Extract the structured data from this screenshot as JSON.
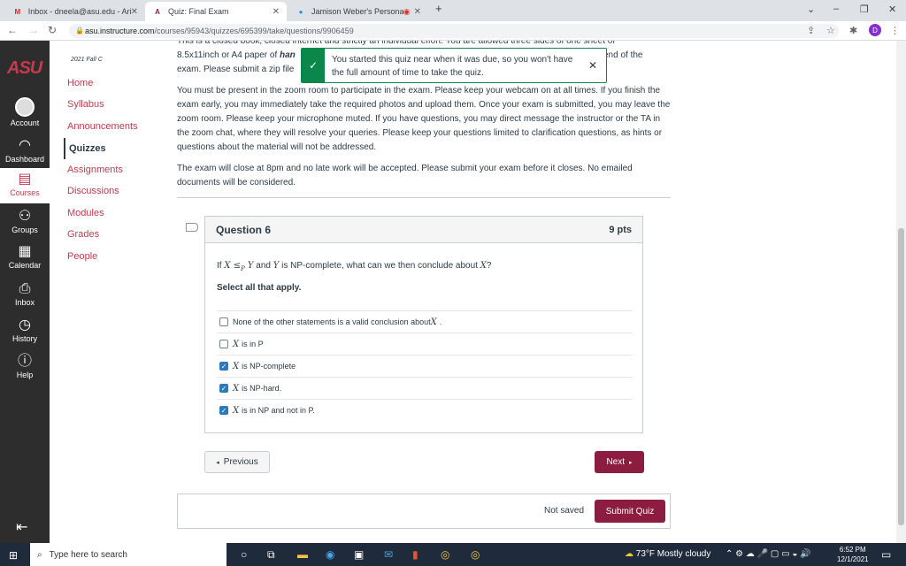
{
  "browser": {
    "tabs": [
      {
        "label": "Inbox - dneela@asu.edu - Arizona",
        "icon": "gmail-icon"
      },
      {
        "label": "Quiz: Final Exam",
        "icon": "asu-icon"
      },
      {
        "label": "Jamison Weber's Personal M",
        "icon": "zoom-icon"
      }
    ],
    "url_host": "asu.instructure.com",
    "url_path": "/courses/95943/quizzes/695399/take/questions/9906459",
    "profile_initial": "D"
  },
  "global_nav": {
    "logo": "ASU",
    "items": [
      {
        "label": "Account",
        "icon": "account-icon"
      },
      {
        "label": "Dashboard",
        "icon": "dashboard-icon"
      },
      {
        "label": "Courses",
        "icon": "courses-icon"
      },
      {
        "label": "Groups",
        "icon": "groups-icon"
      },
      {
        "label": "Calendar",
        "icon": "calendar-icon"
      },
      {
        "label": "Inbox",
        "icon": "inbox-icon"
      },
      {
        "label": "History",
        "icon": "history-icon"
      },
      {
        "label": "Help",
        "icon": "help-icon"
      }
    ]
  },
  "course_nav": {
    "term": "2021 Fall C",
    "items": [
      "Home",
      "Syllabus",
      "Announcements",
      "Quizzes",
      "Assignments",
      "Discussions",
      "Modules",
      "Grades",
      "People"
    ],
    "active": "Quizzes"
  },
  "instructions": {
    "p0": "This is a closed book, closed internet and strictly an individual effort. You are allowed three sides of one sheet of",
    "p1a": "8.5x11inch or A4 paper of ",
    "p1b": "han",
    "p1c": "end of the",
    "p1d": "exam. Please submit a zip file",
    "p2": "You must be present in the zoom room to participate in the exam. Please keep your webcam on at all times. If you finish the exam early, you may immediately take the required photos and upload them. Once your exam is submitted, you may leave the zoom room. Please keep your microphone muted. If you have questions, you may direct message the instructor or the TA in the zoom chat, where they will resolve your queries. Please keep your questions limited to clarification questions, as hints or questions about the material will not be addressed.",
    "p3": "The exam will close at 8pm and no late work will be accepted. Please submit your exam before it closes. No emailed documents will be considered."
  },
  "toast": {
    "message": "You started this quiz near when it was due, so you won't have the full amount of time to take the quiz."
  },
  "question": {
    "title": "Question 6",
    "points": "9 pts",
    "text_pre": "If ",
    "text_math1": "X ≤",
    "text_sub": "P",
    "text_math2": " Y",
    "text_mid": " and ",
    "text_math3": "Y",
    "text_post": " is NP-complete, what can we then conclude about ",
    "text_math4": "X",
    "text_end": "?",
    "instruction": "Select all that apply.",
    "answers": [
      {
        "pre": "None of the other statements is a valid conclusion about ",
        "var": "X",
        "post": ".",
        "checked": false
      },
      {
        "pre": "",
        "var": "X",
        "post": "is in P",
        "checked": false
      },
      {
        "pre": "",
        "var": "X",
        "post": "is NP-complete",
        "checked": true
      },
      {
        "pre": "",
        "var": "X",
        "post": "is NP-hard.",
        "checked": true
      },
      {
        "pre": "",
        "var": "X",
        "post": "is in NP and not in P.",
        "checked": true
      }
    ]
  },
  "buttons": {
    "previous": "Previous",
    "next": "Next",
    "submit": "Submit Quiz",
    "status": "Not saved"
  },
  "taskbar": {
    "search_placeholder": "Type here to search",
    "weather": "73°F  Mostly cloudy",
    "time": "6:52 PM",
    "date": "12/1/2021"
  }
}
